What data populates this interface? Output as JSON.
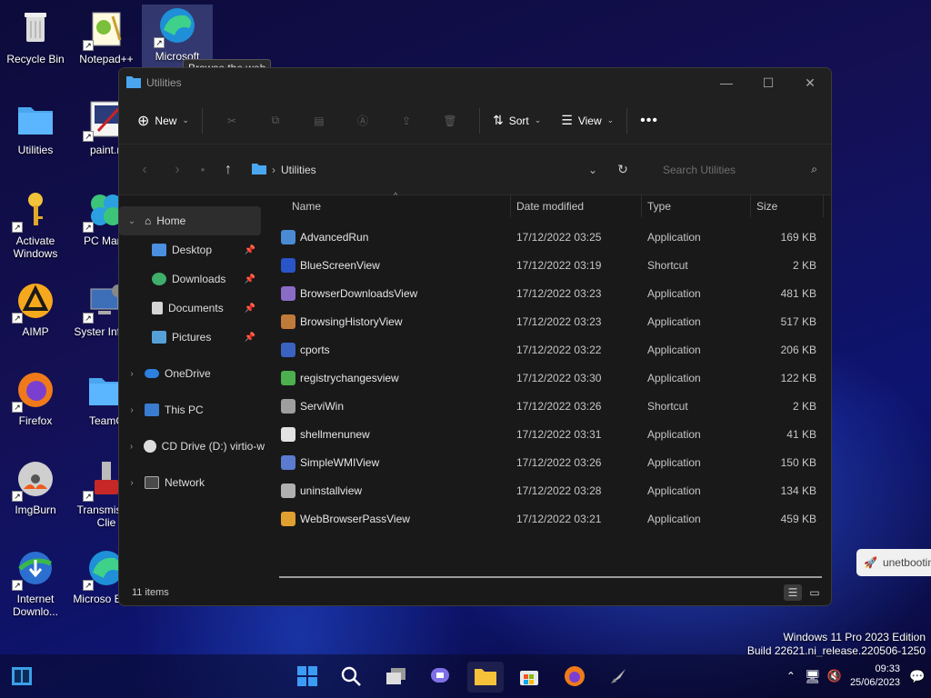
{
  "desktop": {
    "icons": [
      {
        "label": "Recycle Bin",
        "icon": "recycle-bin-icon"
      },
      {
        "label": "Notepad++",
        "icon": "notepad-plus-plus-icon"
      },
      {
        "label": "Microsoft",
        "icon": "edge-icon"
      },
      {
        "label": "Utilities",
        "icon": "folder-icon"
      },
      {
        "label": "paint.n",
        "icon": "paint-net-icon"
      },
      {
        "label": "Activate Windows",
        "icon": "key-icon"
      },
      {
        "label": "PC Mana",
        "icon": "pc-manager-icon"
      },
      {
        "label": "AIMP",
        "icon": "aimp-icon"
      },
      {
        "label": "Syster Inform",
        "icon": "system-info-icon"
      },
      {
        "label": "Firefox",
        "icon": "firefox-icon"
      },
      {
        "label": "TeamC",
        "icon": "folder-icon"
      },
      {
        "label": "ImgBurn",
        "icon": "imgburn-icon"
      },
      {
        "label": "Transmis Qt Clie",
        "icon": "transmission-icon"
      },
      {
        "label": "Internet Downlo...",
        "icon": "idm-icon"
      },
      {
        "label": "Microso Edge",
        "icon": "edge-icon"
      }
    ],
    "tooltip": "Browse the web"
  },
  "window": {
    "title": "Utilities",
    "commands": {
      "new": "New",
      "sort": "Sort",
      "view": "View"
    },
    "path_folder": "Utilities",
    "search_placeholder": "Search Utilities",
    "nav": {
      "home": "Home",
      "quick": [
        {
          "label": "Desktop",
          "icon": "desktop-icon",
          "color": "#4a8fe0"
        },
        {
          "label": "Downloads",
          "icon": "download-icon",
          "color": "#3fae6a"
        },
        {
          "label": "Documents",
          "icon": "document-icon",
          "color": "#d6d6d6"
        },
        {
          "label": "Pictures",
          "icon": "pictures-icon",
          "color": "#56a0d8"
        }
      ],
      "onedrive": "OneDrive",
      "thispc": "This PC",
      "cddrive": "CD Drive (D:) virtio-w",
      "network": "Network"
    },
    "columns": {
      "name": "Name",
      "date": "Date modified",
      "type": "Type",
      "size": "Size"
    },
    "files": [
      {
        "name": "AdvancedRun",
        "date": "17/12/2022 03:25",
        "type": "Application",
        "size": "169 KB",
        "color": "#4b8bd4"
      },
      {
        "name": "BlueScreenView",
        "date": "17/12/2022 03:19",
        "type": "Shortcut",
        "size": "2 KB",
        "color": "#2a55c8"
      },
      {
        "name": "BrowserDownloadsView",
        "date": "17/12/2022 03:23",
        "type": "Application",
        "size": "481 KB",
        "color": "#8a6cc6"
      },
      {
        "name": "BrowsingHistoryView",
        "date": "17/12/2022 03:23",
        "type": "Application",
        "size": "517 KB",
        "color": "#c07a3a"
      },
      {
        "name": "cports",
        "date": "17/12/2022 03:22",
        "type": "Application",
        "size": "206 KB",
        "color": "#3a63c0"
      },
      {
        "name": "registrychangesview",
        "date": "17/12/2022 03:30",
        "type": "Application",
        "size": "122 KB",
        "color": "#4caf50"
      },
      {
        "name": "ServiWin",
        "date": "17/12/2022 03:26",
        "type": "Shortcut",
        "size": "2 KB",
        "color": "#9e9e9e"
      },
      {
        "name": "shellmenunew",
        "date": "17/12/2022 03:31",
        "type": "Application",
        "size": "41 KB",
        "color": "#e2e2e2"
      },
      {
        "name": "SimpleWMIView",
        "date": "17/12/2022 03:26",
        "type": "Application",
        "size": "150 KB",
        "color": "#5a7bd0"
      },
      {
        "name": "uninstallview",
        "date": "17/12/2022 03:28",
        "type": "Application",
        "size": "134 KB",
        "color": "#b0b0b0"
      },
      {
        "name": "WebBrowserPassView",
        "date": "17/12/2022 03:21",
        "type": "Application",
        "size": "459 KB",
        "color": "#e0a030"
      }
    ],
    "status": "11 items"
  },
  "popup": "unetbootin",
  "edition": {
    "line1": "Windows 11 Pro 2023 Edition",
    "line2": "Build 22621.ni_release.220506-1250"
  },
  "taskbar": {
    "time": "09:33",
    "date": "25/06/2023"
  }
}
